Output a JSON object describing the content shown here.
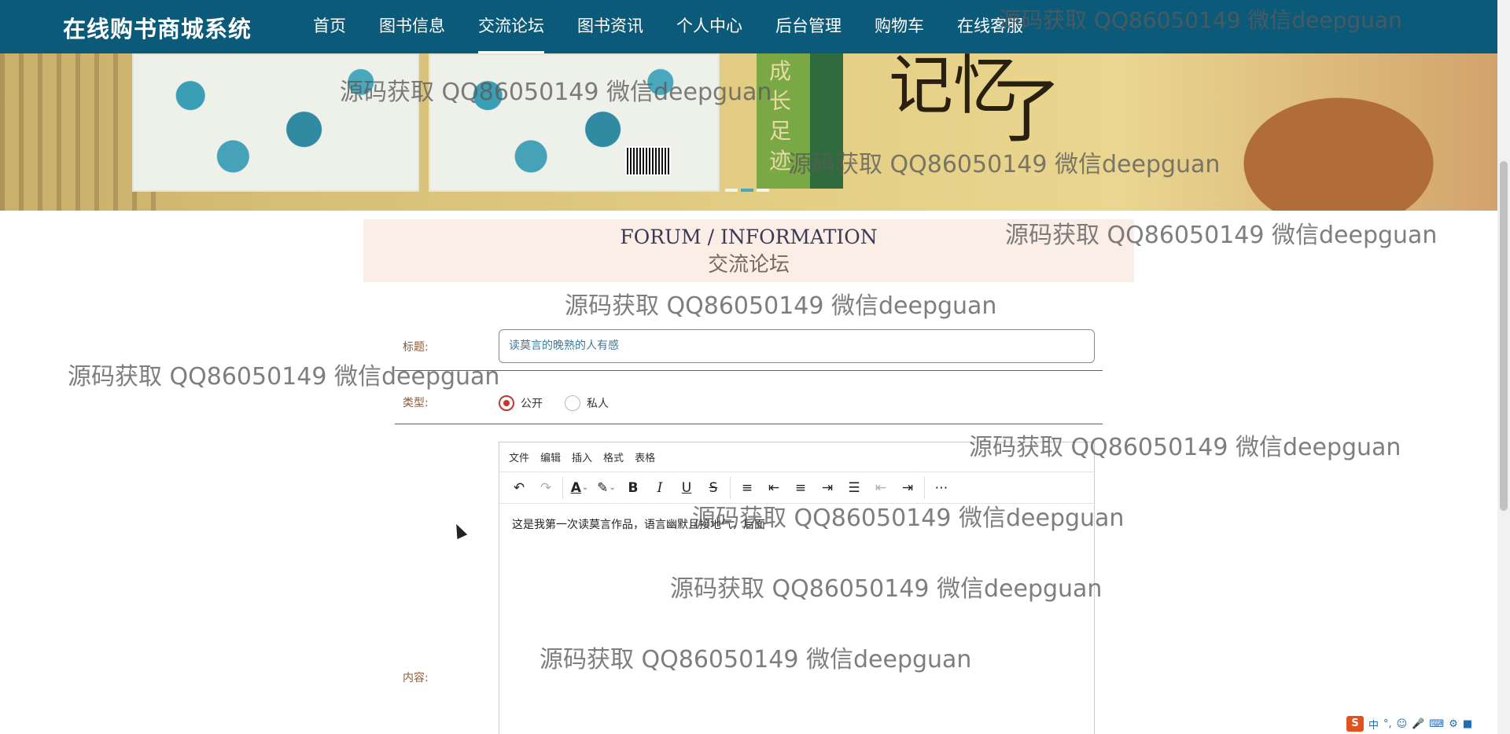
{
  "brand": "在线购书商城系统",
  "nav": [
    {
      "label": "首页",
      "active": false
    },
    {
      "label": "图书信息",
      "active": false
    },
    {
      "label": "交流论坛",
      "active": true
    },
    {
      "label": "图书资讯",
      "active": false
    },
    {
      "label": "个人中心",
      "active": false
    },
    {
      "label": "后台管理",
      "active": false
    },
    {
      "label": "购物车",
      "active": false
    },
    {
      "label": "在线客服",
      "active": false
    }
  ],
  "banner": {
    "band_text": "成长足迹",
    "calligraphy": "记忆",
    "calligraphy2": "了"
  },
  "forum": {
    "title_en": "FORUM / INFORMATION",
    "title_cn": "交流论坛"
  },
  "form": {
    "title_label": "标题:",
    "title_value": "读莫言的晚熟的人有感",
    "type_label": "类型:",
    "type_options": [
      "公开",
      "私人"
    ],
    "type_selected": "公开",
    "content_label": "内容:",
    "content_value": "这是我第一次读莫言作品，语言幽默且接地气，后面"
  },
  "editor": {
    "menus": [
      "文件",
      "编辑",
      "插入",
      "格式",
      "表格"
    ],
    "toolbar_icons": [
      "undo-icon",
      "redo-icon",
      "text-color-icon",
      "highlight-icon",
      "bold-icon",
      "italic-icon",
      "underline-icon",
      "strikethrough-icon",
      "line-height-icon",
      "align-left-icon",
      "align-center-icon",
      "align-right-icon",
      "align-justify-icon",
      "outdent-icon",
      "indent-icon",
      "more-icon"
    ]
  },
  "watermark": "源码获取 QQ86050149 微信deepguan",
  "tray": {
    "ime": "中"
  },
  "colors": {
    "nav_bg": "#0c5a7a",
    "forum_bg": "#fbeee6",
    "radio_accent": "#c0392b"
  }
}
